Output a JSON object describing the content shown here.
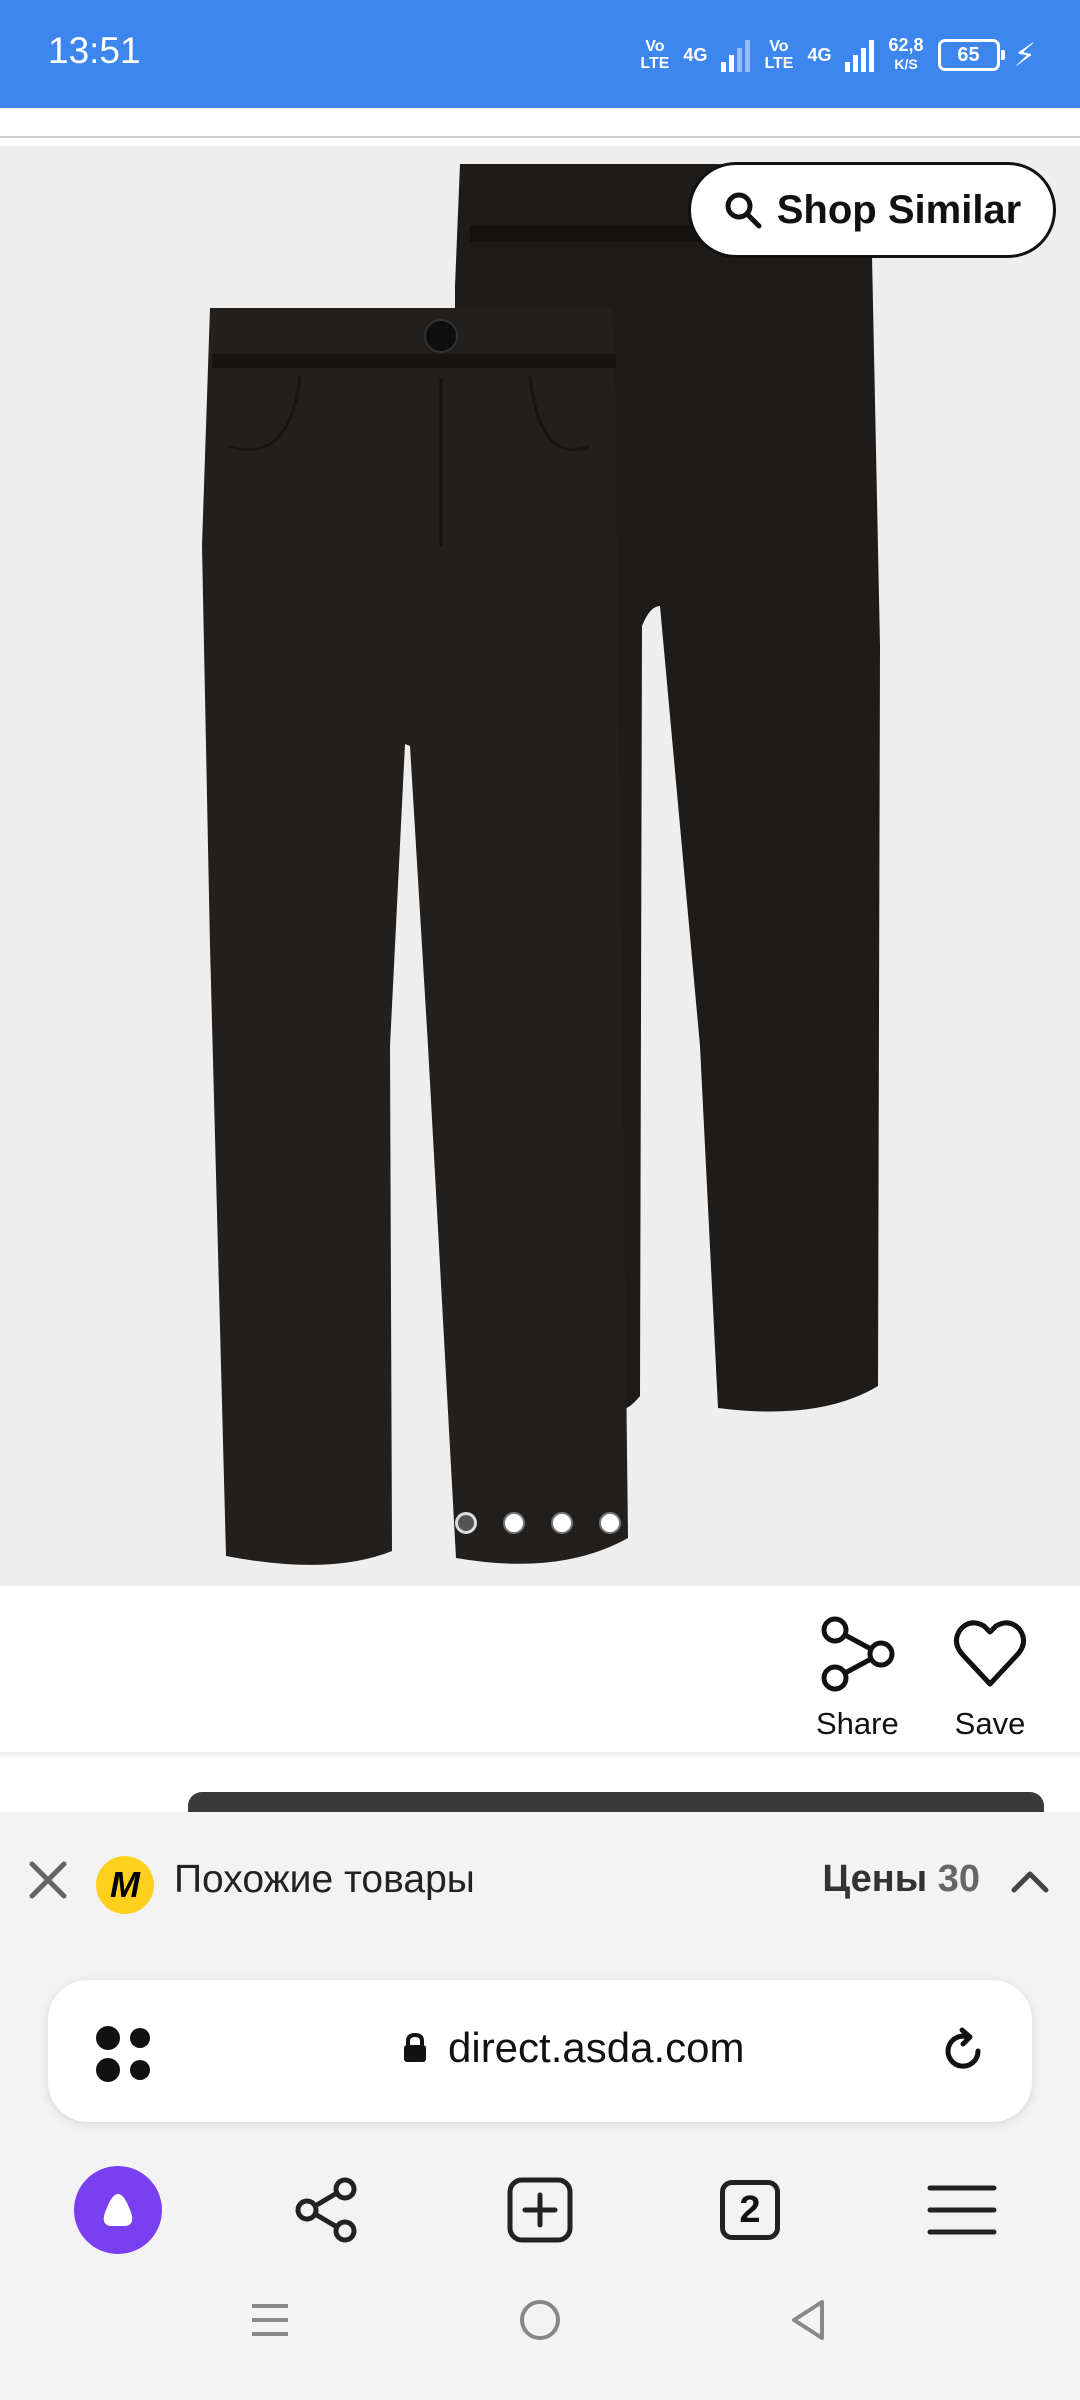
{
  "status_bar": {
    "time": "13:51",
    "volte1_top": "Vo",
    "volte1_bottom": "LTE",
    "net1": "4G",
    "volte2_top": "Vo",
    "volte2_bottom": "LTE",
    "net2": "4G",
    "speed_value": "62,8",
    "speed_unit": "K/S",
    "battery": "65",
    "icons": [
      "signal-icon",
      "charging-icon"
    ]
  },
  "product": {
    "shop_similar_label": "Shop Similar",
    "image_dots": {
      "count": 4,
      "active_index": 0
    }
  },
  "actions": {
    "share_label": "Share",
    "save_label": "Save"
  },
  "similar_bar": {
    "title": "Похожие товары",
    "prices_label": "Цены",
    "prices_count": "30",
    "logo_letter": "M",
    "colors": {
      "logo": "#ffd11c"
    }
  },
  "browser": {
    "url": "direct.asda.com",
    "tab_count": "2",
    "colors": {
      "alice": "#7b3ff2",
      "status_bar": "#3d86ee"
    }
  }
}
